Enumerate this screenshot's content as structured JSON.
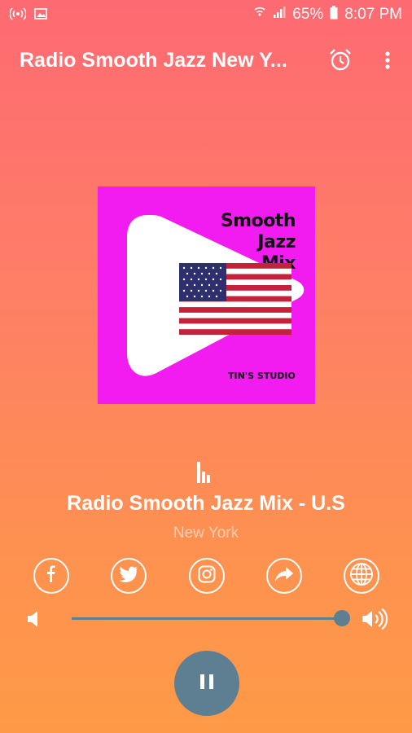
{
  "status": {
    "battery": "65%",
    "time": "8:07 PM"
  },
  "app_bar": {
    "title": "Radio Smooth Jazz New Y..."
  },
  "station": {
    "art_title_line1": "Smooth Jazz",
    "art_title_line2": "Mix",
    "art_footer": "TIN'S STUDIO",
    "name": "Radio Smooth Jazz Mix - U.S",
    "location": "New York"
  },
  "social": [
    "facebook-icon",
    "twitter-icon",
    "instagram-icon",
    "share-icon",
    "globe-icon"
  ],
  "volume": {
    "level": 1.0
  },
  "player": {
    "state": "playing"
  },
  "colors": {
    "gradient_top": "#fe6a72",
    "gradient_bottom": "#fe9a47",
    "accent": "#5e7f91",
    "art_background": "#f21cf0"
  }
}
